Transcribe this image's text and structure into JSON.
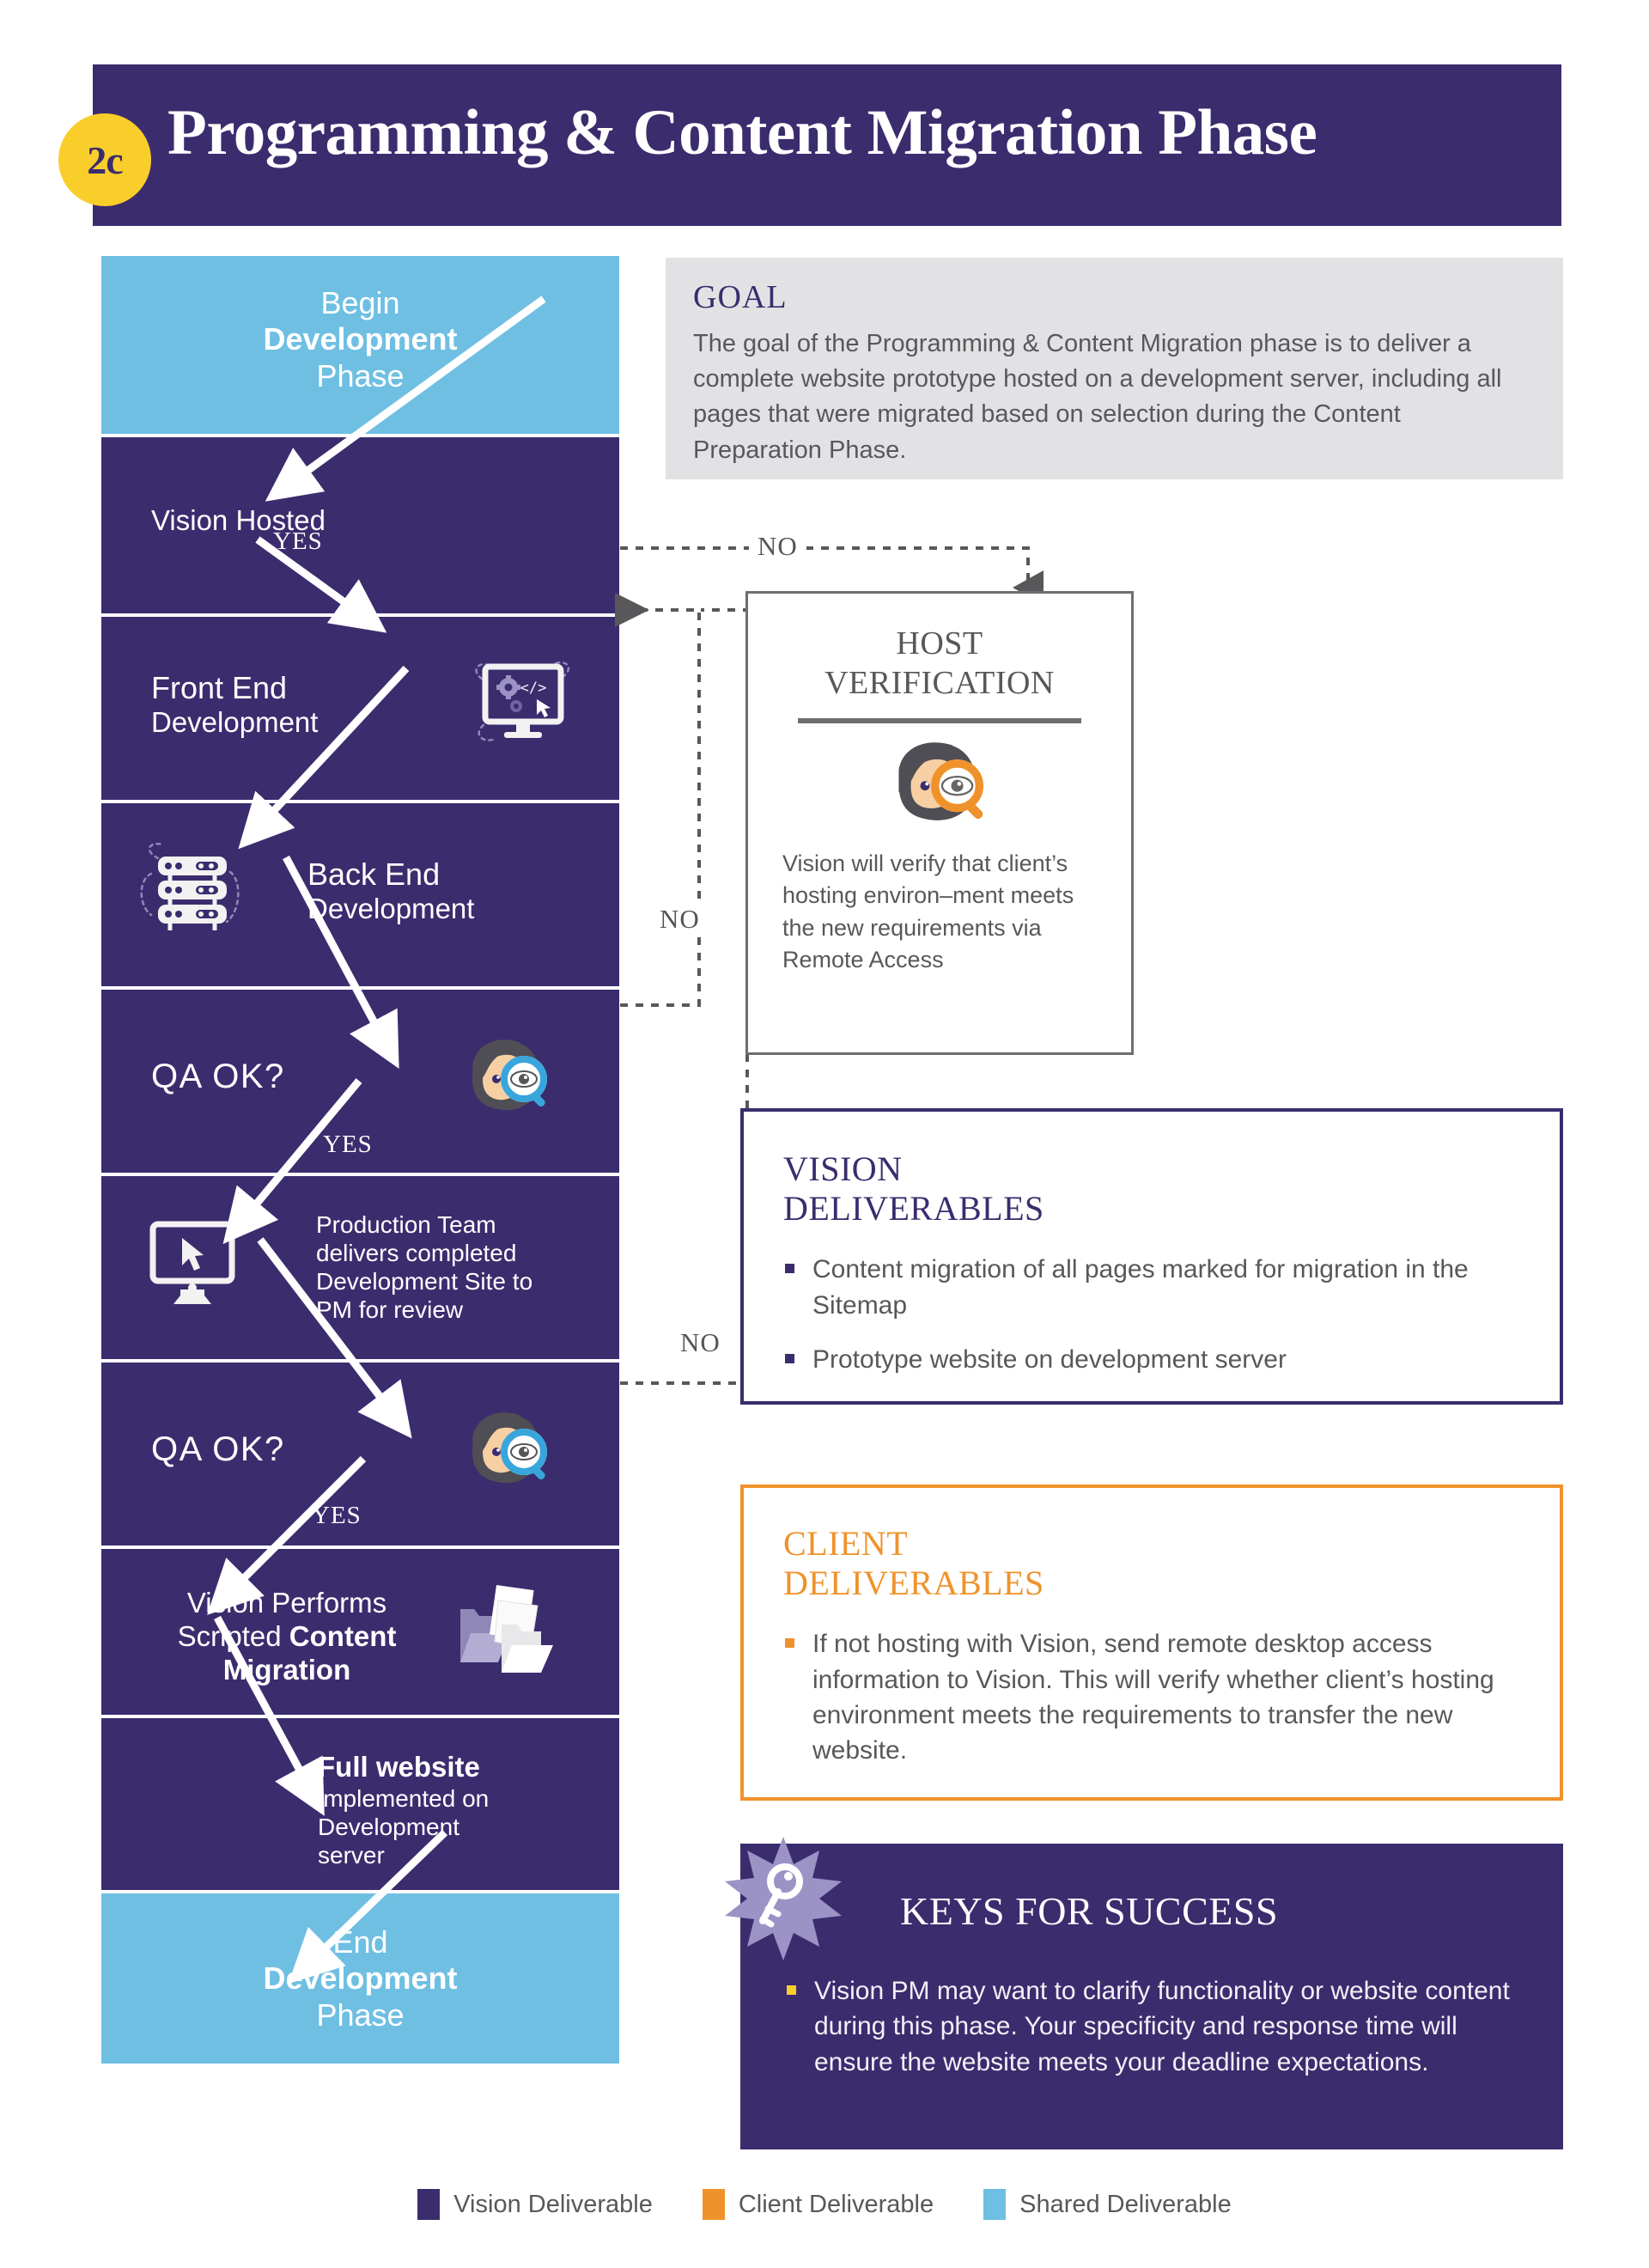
{
  "header": {
    "badge": "2c",
    "title": "Programming & Content Migration Phase",
    "bar_color": "#3B2C6E",
    "badge_color": "#FACE2A"
  },
  "colors": {
    "vision_purple": "#3B2C6E",
    "shared_blue": "#6FBFE3",
    "client_orange": "#F0922B",
    "yellow": "#FACE2A",
    "gray_text": "#58585B",
    "goal_bg": "#E2E2E4"
  },
  "flow": {
    "rows": [
      {
        "id": "begin",
        "type": "shared",
        "lines": [
          "Begin",
          "Development",
          "Phase"
        ],
        "bold_index": 1,
        "icon": null
      },
      {
        "id": "vision-hosted",
        "type": "vision",
        "lines": [
          "Vision Hosted"
        ],
        "branch": "YES",
        "icon": null
      },
      {
        "id": "front-end",
        "type": "vision",
        "lines": [
          "Front End",
          "Development"
        ],
        "bold_index": 0,
        "icon": "monitor-code-icon"
      },
      {
        "id": "back-end",
        "type": "vision",
        "lines": [
          "Back End",
          "Development"
        ],
        "bold_index": 0,
        "icon": "server-rack-icon"
      },
      {
        "id": "qa-ok-1",
        "type": "vision",
        "lines": [
          "QA OK?"
        ],
        "branch": "YES",
        "icon": "qa-inspector-icon"
      },
      {
        "id": "production-team",
        "type": "vision",
        "lines": [
          "Production Team",
          "delivers completed",
          "Development Site to",
          "PM for review"
        ],
        "icon": "monitor-cursor-icon"
      },
      {
        "id": "qa-ok-2",
        "type": "vision",
        "lines": [
          "QA OK?"
        ],
        "branch": "YES",
        "icon": "qa-inspector-icon"
      },
      {
        "id": "content-migration",
        "type": "vision",
        "lines": [
          "Vision Performs",
          "Scripted Content",
          "Migration"
        ],
        "icon": "folders-files-icon"
      },
      {
        "id": "full-website",
        "type": "vision",
        "lines": [
          "Full website",
          "implemented on",
          "Development",
          "server"
        ],
        "bold_index": 0,
        "icon": null
      },
      {
        "id": "end",
        "type": "shared",
        "lines": [
          "End",
          "Development",
          "Phase"
        ],
        "bold_index": 1,
        "icon": null
      }
    ],
    "yes_label": "YES",
    "no_label": "NO"
  },
  "goal": {
    "title": "GOAL",
    "body": "The goal of the Programming & Content Migration phase is to deliver a complete website prototype hosted on a development server, including all pages that were migrated based on selection during the Content Preparation Phase."
  },
  "host_verification": {
    "title_line1": "HOST",
    "title_line2": "VERIFICATION",
    "body": "Vision will verify that client’s hosting environ–ment meets the new requirements via Remote Access",
    "icon": "host-inspector-icon"
  },
  "vision_deliverables": {
    "title_line1": "VISION",
    "title_line2": "DELIVERABLES",
    "items": [
      "Content migration of all pages marked for migration in the Sitemap",
      "Prototype website on development server"
    ]
  },
  "client_deliverables": {
    "title_line1": "CLIENT",
    "title_line2": "DELIVERABLES",
    "items": [
      "If not hosting with Vision, send remote desktop access information to Vision. This will verify whether client’s hosting environment meets the requirements to transfer the new website."
    ]
  },
  "keys_for_success": {
    "title": "KEYS FOR SUCCESS",
    "icon": "key-star-icon",
    "items": [
      "Vision PM may want to clarify functionality or website content during this phase. Your specificity and response time will ensure the website meets your deadline expectations."
    ]
  },
  "legend": {
    "items": [
      {
        "label": "Vision Deliverable",
        "color": "#3B2C6E"
      },
      {
        "label": "Client Deliverable",
        "color": "#F0922B"
      },
      {
        "label": "Shared Deliverable",
        "color": "#6FBFE3"
      }
    ]
  }
}
